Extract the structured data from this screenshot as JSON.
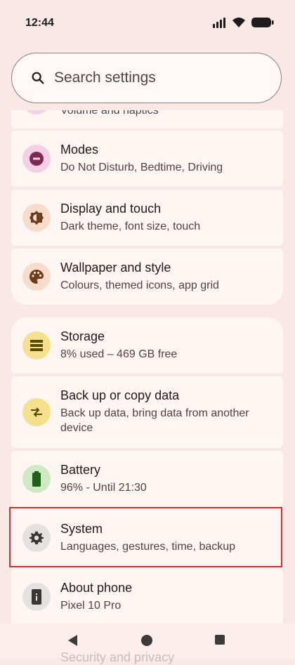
{
  "status": {
    "time": "12:44"
  },
  "search": {
    "placeholder": "Search settings"
  },
  "items": [
    {
      "title": "",
      "subtitle": "Volume and haptics",
      "icon": "volume-icon"
    },
    {
      "title": "Modes",
      "subtitle": "Do Not Disturb, Bedtime, Driving",
      "icon": "do-not-disturb-icon"
    },
    {
      "title": "Display and touch",
      "subtitle": "Dark theme, font size, touch",
      "icon": "brightness-icon"
    },
    {
      "title": "Wallpaper and style",
      "subtitle": "Colours, themed icons, app grid",
      "icon": "palette-icon"
    },
    {
      "title": "Storage",
      "subtitle": "8% used – 469 GB free",
      "icon": "storage-icon"
    },
    {
      "title": "Back up or copy data",
      "subtitle": "Back up data, bring data from another device",
      "icon": "swap-icon"
    },
    {
      "title": "Battery",
      "subtitle": "96% - Until 21:30",
      "icon": "battery-icon"
    },
    {
      "title": "System",
      "subtitle": "Languages, gestures, time, backup",
      "icon": "gear-icon"
    },
    {
      "title": "About phone",
      "subtitle": "Pixel 10 Pro",
      "icon": "phone-info-icon"
    },
    {
      "title": "Security and privacy",
      "subtitle": "",
      "icon": "security-icon"
    }
  ],
  "colors": {
    "accent_pink": "#f5d0e4",
    "accent_peach": "#f7dccb",
    "accent_yellow": "#f5e08d",
    "accent_green": "#cfe9c5",
    "accent_grey": "#e4e1e0",
    "highlight": "#d0312d"
  }
}
